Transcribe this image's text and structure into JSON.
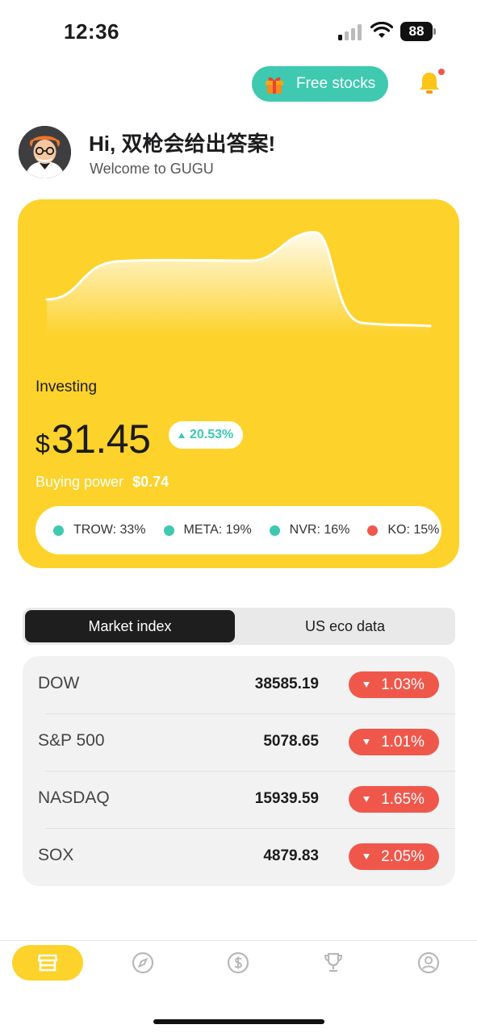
{
  "status_bar": {
    "time": "12:36",
    "battery": "88"
  },
  "header": {
    "free_stocks_label": "Free stocks",
    "greeting": "Hi, 双枪会给出答案!",
    "welcome": "Welcome to GUGU"
  },
  "portfolio": {
    "investing_label": "Investing",
    "currency_symbol": "$",
    "value": "31.45",
    "change": "20.53%",
    "buying_power_label": "Buying power",
    "buying_power_value": "$0.74",
    "holdings": [
      {
        "label": "TROW: 33%",
        "color": "#3ec9b0"
      },
      {
        "label": "META: 19%",
        "color": "#3ec9b0"
      },
      {
        "label": "NVR: 16%",
        "color": "#3ec9b0"
      },
      {
        "label": "KO: 15%",
        "color": "#f0574b"
      }
    ]
  },
  "tabs": {
    "market_index": "Market index",
    "us_eco_data": "US eco data"
  },
  "indices": [
    {
      "name": "DOW",
      "value": "38585.19",
      "change": "1.03%"
    },
    {
      "name": "S&P 500",
      "value": "5078.65",
      "change": "1.01%"
    },
    {
      "name": "NASDAQ",
      "value": "15939.59",
      "change": "1.65%"
    },
    {
      "name": "SOX",
      "value": "4879.83",
      "change": "2.05%"
    }
  ],
  "nav": [
    {
      "icon": "store-icon",
      "active": true
    },
    {
      "icon": "compass-icon",
      "active": false
    },
    {
      "icon": "dollar-icon",
      "active": false
    },
    {
      "icon": "trophy-icon",
      "active": false
    },
    {
      "icon": "profile-icon",
      "active": false
    }
  ],
  "colors": {
    "accent": "#fdd22a",
    "teal": "#3ec9b0",
    "red": "#f0574b"
  }
}
